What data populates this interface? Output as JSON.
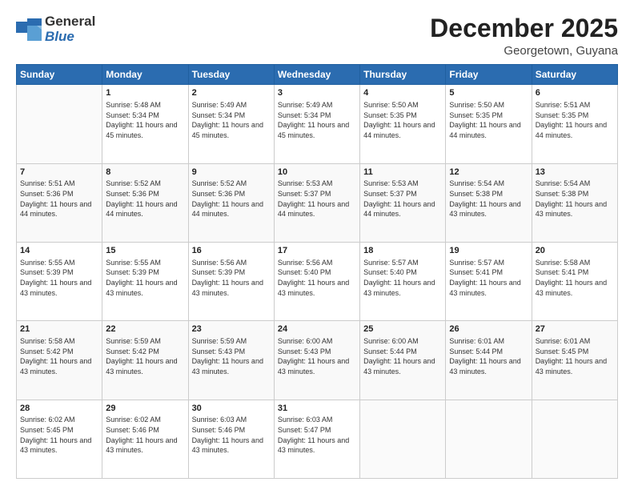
{
  "header": {
    "logo_general": "General",
    "logo_blue": "Blue",
    "month_title": "December 2025",
    "location": "Georgetown, Guyana"
  },
  "days_of_week": [
    "Sunday",
    "Monday",
    "Tuesday",
    "Wednesday",
    "Thursday",
    "Friday",
    "Saturday"
  ],
  "weeks": [
    [
      {
        "day": "",
        "info": ""
      },
      {
        "day": "1",
        "info": "Sunrise: 5:48 AM\nSunset: 5:34 PM\nDaylight: 11 hours and 45 minutes."
      },
      {
        "day": "2",
        "info": "Sunrise: 5:49 AM\nSunset: 5:34 PM\nDaylight: 11 hours and 45 minutes."
      },
      {
        "day": "3",
        "info": "Sunrise: 5:49 AM\nSunset: 5:34 PM\nDaylight: 11 hours and 45 minutes."
      },
      {
        "day": "4",
        "info": "Sunrise: 5:50 AM\nSunset: 5:35 PM\nDaylight: 11 hours and 44 minutes."
      },
      {
        "day": "5",
        "info": "Sunrise: 5:50 AM\nSunset: 5:35 PM\nDaylight: 11 hours and 44 minutes."
      },
      {
        "day": "6",
        "info": "Sunrise: 5:51 AM\nSunset: 5:35 PM\nDaylight: 11 hours and 44 minutes."
      }
    ],
    [
      {
        "day": "7",
        "info": "Sunrise: 5:51 AM\nSunset: 5:36 PM\nDaylight: 11 hours and 44 minutes."
      },
      {
        "day": "8",
        "info": "Sunrise: 5:52 AM\nSunset: 5:36 PM\nDaylight: 11 hours and 44 minutes."
      },
      {
        "day": "9",
        "info": "Sunrise: 5:52 AM\nSunset: 5:36 PM\nDaylight: 11 hours and 44 minutes."
      },
      {
        "day": "10",
        "info": "Sunrise: 5:53 AM\nSunset: 5:37 PM\nDaylight: 11 hours and 44 minutes."
      },
      {
        "day": "11",
        "info": "Sunrise: 5:53 AM\nSunset: 5:37 PM\nDaylight: 11 hours and 44 minutes."
      },
      {
        "day": "12",
        "info": "Sunrise: 5:54 AM\nSunset: 5:38 PM\nDaylight: 11 hours and 43 minutes."
      },
      {
        "day": "13",
        "info": "Sunrise: 5:54 AM\nSunset: 5:38 PM\nDaylight: 11 hours and 43 minutes."
      }
    ],
    [
      {
        "day": "14",
        "info": "Sunrise: 5:55 AM\nSunset: 5:39 PM\nDaylight: 11 hours and 43 minutes."
      },
      {
        "day": "15",
        "info": "Sunrise: 5:55 AM\nSunset: 5:39 PM\nDaylight: 11 hours and 43 minutes."
      },
      {
        "day": "16",
        "info": "Sunrise: 5:56 AM\nSunset: 5:39 PM\nDaylight: 11 hours and 43 minutes."
      },
      {
        "day": "17",
        "info": "Sunrise: 5:56 AM\nSunset: 5:40 PM\nDaylight: 11 hours and 43 minutes."
      },
      {
        "day": "18",
        "info": "Sunrise: 5:57 AM\nSunset: 5:40 PM\nDaylight: 11 hours and 43 minutes."
      },
      {
        "day": "19",
        "info": "Sunrise: 5:57 AM\nSunset: 5:41 PM\nDaylight: 11 hours and 43 minutes."
      },
      {
        "day": "20",
        "info": "Sunrise: 5:58 AM\nSunset: 5:41 PM\nDaylight: 11 hours and 43 minutes."
      }
    ],
    [
      {
        "day": "21",
        "info": "Sunrise: 5:58 AM\nSunset: 5:42 PM\nDaylight: 11 hours and 43 minutes."
      },
      {
        "day": "22",
        "info": "Sunrise: 5:59 AM\nSunset: 5:42 PM\nDaylight: 11 hours and 43 minutes."
      },
      {
        "day": "23",
        "info": "Sunrise: 5:59 AM\nSunset: 5:43 PM\nDaylight: 11 hours and 43 minutes."
      },
      {
        "day": "24",
        "info": "Sunrise: 6:00 AM\nSunset: 5:43 PM\nDaylight: 11 hours and 43 minutes."
      },
      {
        "day": "25",
        "info": "Sunrise: 6:00 AM\nSunset: 5:44 PM\nDaylight: 11 hours and 43 minutes."
      },
      {
        "day": "26",
        "info": "Sunrise: 6:01 AM\nSunset: 5:44 PM\nDaylight: 11 hours and 43 minutes."
      },
      {
        "day": "27",
        "info": "Sunrise: 6:01 AM\nSunset: 5:45 PM\nDaylight: 11 hours and 43 minutes."
      }
    ],
    [
      {
        "day": "28",
        "info": "Sunrise: 6:02 AM\nSunset: 5:45 PM\nDaylight: 11 hours and 43 minutes."
      },
      {
        "day": "29",
        "info": "Sunrise: 6:02 AM\nSunset: 5:46 PM\nDaylight: 11 hours and 43 minutes."
      },
      {
        "day": "30",
        "info": "Sunrise: 6:03 AM\nSunset: 5:46 PM\nDaylight: 11 hours and 43 minutes."
      },
      {
        "day": "31",
        "info": "Sunrise: 6:03 AM\nSunset: 5:47 PM\nDaylight: 11 hours and 43 minutes."
      },
      {
        "day": "",
        "info": ""
      },
      {
        "day": "",
        "info": ""
      },
      {
        "day": "",
        "info": ""
      }
    ]
  ]
}
